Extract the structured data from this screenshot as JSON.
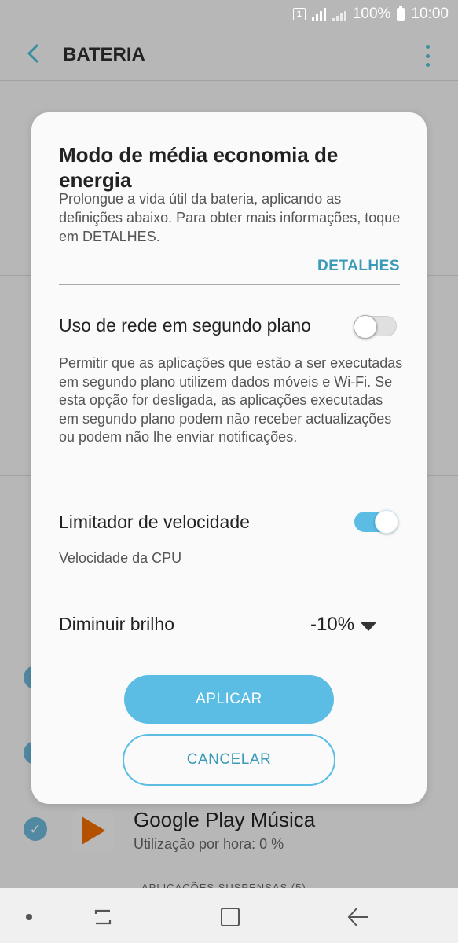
{
  "status_bar": {
    "sim": "1",
    "battery_percent": "100%",
    "time": "10:00"
  },
  "app_bar": {
    "title": "BATERIA"
  },
  "background": {
    "app_name": "Google Play Música",
    "app_usage": "Utilização por hora: 0 %",
    "suspended_label": "APLICAÇÕES SUSPENSAS (5)"
  },
  "dialog": {
    "title": "Modo de média economia de energia",
    "description": "Prolongue a vida útil da bateria, aplicando as definições abaixo. Para obter mais informações, toque em DETALHES.",
    "details_link": "DETALHES",
    "settings": [
      {
        "label": "Uso de rede em segundo plano",
        "enabled": false,
        "description": "Permitir que as aplicações que estão a ser executadas em segundo plano utilizem dados móveis e Wi-Fi. Se esta opção for desligada, as aplicações executadas em segundo plano podem não receber actualizações ou podem não lhe enviar notificações."
      },
      {
        "label": "Limitador de velocidade",
        "enabled": true,
        "description": "Velocidade da CPU"
      },
      {
        "label": "Diminuir brilho",
        "value": "-10%"
      }
    ],
    "apply_label": "APLICAR",
    "cancel_label": "CANCELAR"
  },
  "colors": {
    "accent": "#5bbde4",
    "accent_text": "#3a9ab8"
  }
}
